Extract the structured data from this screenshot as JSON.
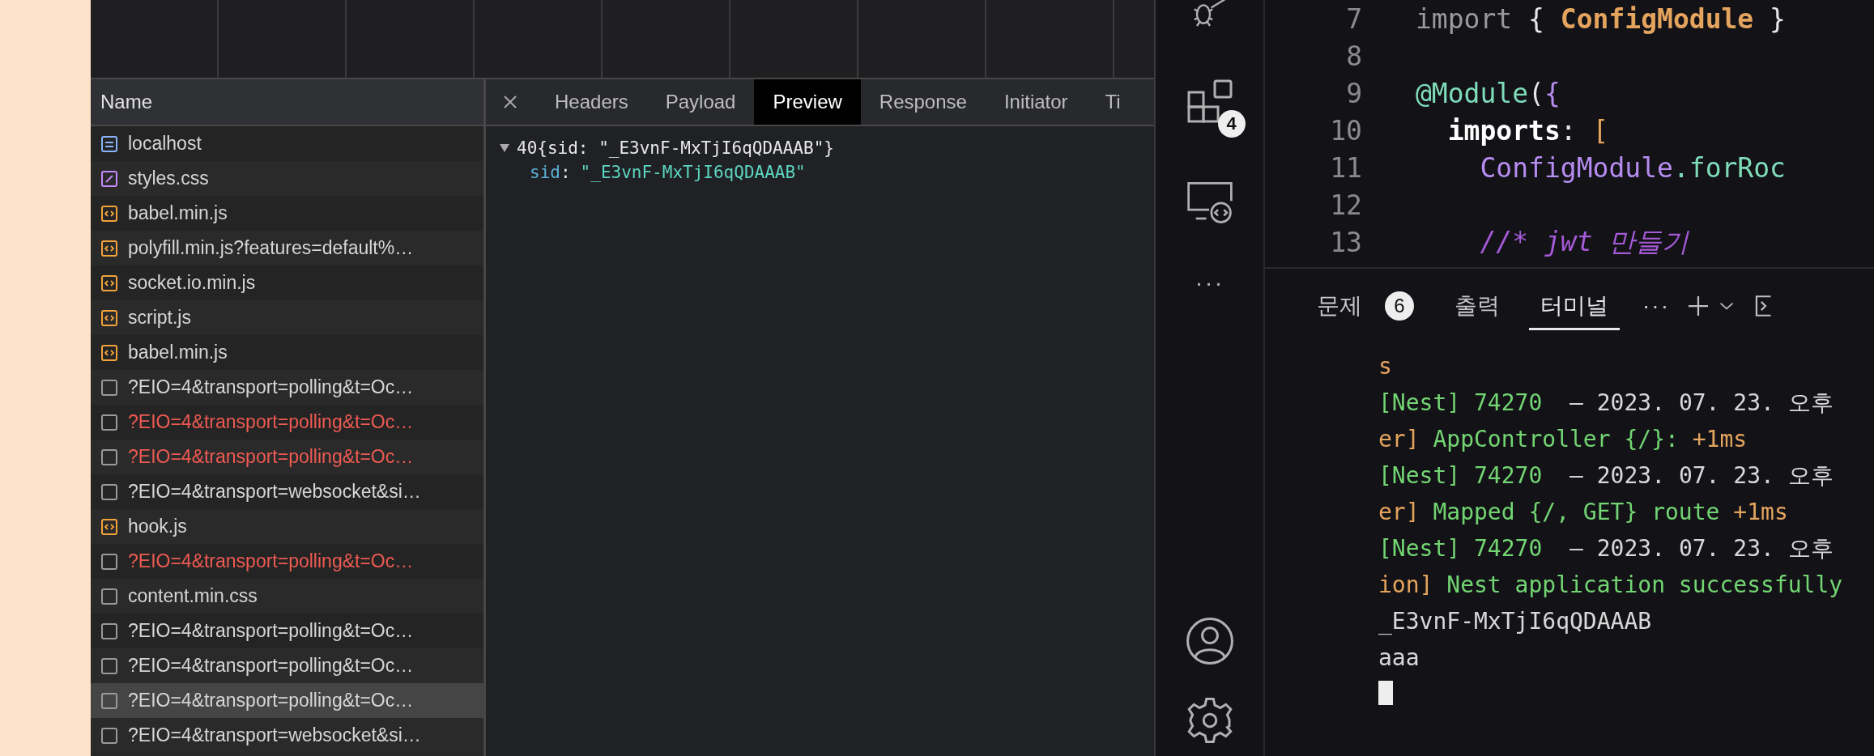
{
  "network": {
    "name_column": {
      "heading": "Name"
    },
    "requests": [
      {
        "name": "localhost",
        "kind": "document",
        "error": false,
        "selected": false
      },
      {
        "name": "styles.css",
        "kind": "stylesheet",
        "error": false,
        "selected": false
      },
      {
        "name": "babel.min.js",
        "kind": "script",
        "error": false,
        "selected": false
      },
      {
        "name": "polyfill.min.js?features=default%…",
        "kind": "script",
        "error": false,
        "selected": false
      },
      {
        "name": "socket.io.min.js",
        "kind": "script",
        "error": false,
        "selected": false
      },
      {
        "name": "script.js",
        "kind": "script",
        "error": false,
        "selected": false
      },
      {
        "name": "babel.min.js",
        "kind": "script",
        "error": false,
        "selected": false
      },
      {
        "name": "?EIO=4&transport=polling&t=Oc…",
        "kind": "other",
        "error": false,
        "selected": false
      },
      {
        "name": "?EIO=4&transport=polling&t=Oc…",
        "kind": "other",
        "error": true,
        "selected": false
      },
      {
        "name": "?EIO=4&transport=polling&t=Oc…",
        "kind": "other",
        "error": true,
        "selected": false
      },
      {
        "name": "?EIO=4&transport=websocket&si…",
        "kind": "other",
        "error": false,
        "selected": false
      },
      {
        "name": "hook.js",
        "kind": "script",
        "error": false,
        "selected": false
      },
      {
        "name": "?EIO=4&transport=polling&t=Oc…",
        "kind": "other",
        "error": true,
        "selected": false
      },
      {
        "name": "content.min.css",
        "kind": "other",
        "error": false,
        "selected": false
      },
      {
        "name": "?EIO=4&transport=polling&t=Oc…",
        "kind": "other",
        "error": false,
        "selected": false
      },
      {
        "name": "?EIO=4&transport=polling&t=Oc…",
        "kind": "other",
        "error": false,
        "selected": false
      },
      {
        "name": "?EIO=4&transport=polling&t=Oc…",
        "kind": "other",
        "error": false,
        "selected": true
      },
      {
        "name": "?EIO=4&transport=websocket&si…",
        "kind": "other",
        "error": false,
        "selected": false
      }
    ],
    "tabs": [
      {
        "label": "Headers",
        "selected": false
      },
      {
        "label": "Payload",
        "selected": false
      },
      {
        "label": "Preview",
        "selected": true
      },
      {
        "label": "Response",
        "selected": false
      },
      {
        "label": "Initiator",
        "selected": false
      },
      {
        "label": "Ti",
        "selected": false
      }
    ],
    "preview": {
      "expanded": true,
      "summary": "40{sid: \"_E3vnF-MxTjI6qQDAAAB\"}",
      "key": "sid",
      "separator": ":",
      "value": "\"_E3vnF-MxTjI6qQDAAAB\""
    }
  },
  "editor": {
    "extensions_badge": "4",
    "more_label": "···",
    "lines": [
      {
        "number": "7",
        "tokens": [
          {
            "kind": "keyword",
            "text": "import "
          },
          {
            "kind": "plain",
            "text": "{ "
          },
          {
            "kind": "type",
            "text": "ConfigModule"
          },
          {
            "kind": "plain",
            "text": " }"
          }
        ]
      },
      {
        "number": "8"
      },
      {
        "number": "9",
        "tokens": [
          {
            "kind": "decorator",
            "text": "@Module"
          },
          {
            "kind": "plain",
            "text": "("
          },
          {
            "kind": "brace",
            "text": "{"
          }
        ]
      },
      {
        "number": "10",
        "tokens": [
          {
            "kind": "property",
            "text": "  imports"
          },
          {
            "kind": "plain",
            "text": ": "
          },
          {
            "kind": "bracket",
            "text": "["
          }
        ]
      },
      {
        "number": "11",
        "tokens": [
          {
            "kind": "class",
            "text": "    ConfigModule"
          },
          {
            "kind": "method",
            "text": ".forRoc"
          }
        ]
      },
      {
        "number": "12"
      },
      {
        "number": "13",
        "tokens": [
          {
            "kind": "comment",
            "text": "    //* jwt 만들기"
          }
        ]
      }
    ]
  },
  "panel": {
    "tabs": [
      {
        "label": "문제",
        "badge": "6",
        "selected": false
      },
      {
        "label": "출력",
        "selected": false
      },
      {
        "label": "터미널",
        "selected": true
      }
    ],
    "more_label": "···",
    "terminal": [
      [
        {
          "kind": "warn",
          "text": "s"
        }
      ],
      [
        {
          "kind": "ok",
          "text": "[Nest] 74270  "
        },
        {
          "kind": "plain",
          "text": "– 2023. 07. 23. 오후"
        }
      ],
      [
        {
          "kind": "warn",
          "text": "er] "
        },
        {
          "kind": "ok",
          "text": "AppController {/}: "
        },
        {
          "kind": "warn",
          "text": "+1ms"
        }
      ],
      [
        {
          "kind": "ok",
          "text": "[Nest] 74270  "
        },
        {
          "kind": "plain",
          "text": "– 2023. 07. 23. 오후"
        }
      ],
      [
        {
          "kind": "warn",
          "text": "er] "
        },
        {
          "kind": "ok",
          "text": "Mapped {/, GET} route "
        },
        {
          "kind": "warn",
          "text": "+1ms"
        }
      ],
      [
        {
          "kind": "ok",
          "text": "[Nest] 74270  "
        },
        {
          "kind": "plain",
          "text": "– 2023. 07. 23. 오후"
        }
      ],
      [
        {
          "kind": "warn",
          "text": "ion] "
        },
        {
          "kind": "ok",
          "text": "Nest application successfully"
        }
      ],
      [
        {
          "kind": "plain",
          "text": "_E3vnF-MxTjI6qQDAAAB"
        }
      ],
      [
        {
          "kind": "plain",
          "text": "aaa"
        }
      ]
    ]
  }
}
